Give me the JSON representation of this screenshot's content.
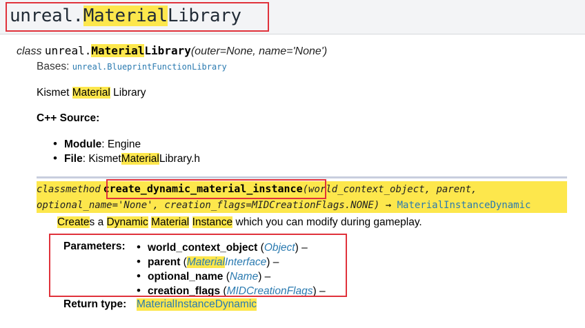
{
  "page": {
    "title": {
      "prefix": "unreal.",
      "highlight": "Material",
      "suffix": "Library"
    }
  },
  "class_signature": {
    "keyword": "class",
    "module": "unreal.",
    "name_highlight": "Material",
    "name_suffix": "Library",
    "args": "(outer=None, name='None')"
  },
  "bases": {
    "label": "Bases:",
    "link": "unreal.BlueprintFunctionLibrary"
  },
  "description": {
    "before": "Kismet ",
    "highlight": "Material",
    "after": " Library"
  },
  "cpp_source": {
    "label": "C++ Source:"
  },
  "source_items": [
    {
      "label": "Module",
      "sep": ": ",
      "value": "Engine"
    },
    {
      "label": "File",
      "sep": ": ",
      "value_pre": "Kismet",
      "value_hl": "Material",
      "value_post": "Library.h"
    }
  ],
  "method": {
    "keyword": "classmethod",
    "name": "create_dynamic_material_instance",
    "args_line1": "(world_context_object, parent,",
    "args_line2": "optional_name='None', creation_flags=MIDCreationFlags.NONE)",
    "arrow": " → ",
    "return_type": "MaterialInstanceDynamic"
  },
  "method_description": {
    "w1": "Create",
    "t1": "s a ",
    "w2": "Dynamic",
    "t2": " ",
    "w3": "Material",
    "t3": " ",
    "w4": "Instance",
    "t4": " which you can modify during gameplay."
  },
  "parameters": {
    "label": "Parameters:",
    "items": [
      {
        "name": "world_context_object",
        "open": " (",
        "type": "Object",
        "close": ") –"
      },
      {
        "name": "parent",
        "open": " (",
        "type_hl": "Material",
        "type_rest": "Interface",
        "close": ") –"
      },
      {
        "name": "optional_name",
        "open": " (",
        "type": "Name",
        "close": ") –"
      },
      {
        "name": "creation_flags",
        "open": " (",
        "type": "MIDCreationFlags",
        "close": ") –"
      }
    ]
  },
  "return_type": {
    "label": "Return type:",
    "value": "MaterialInstanceDynamic"
  },
  "colors": {
    "highlight": "#fde74c",
    "link": "#2a7ab0",
    "annotation_box": "#e0313a",
    "header_background": "#f3f4f6"
  }
}
